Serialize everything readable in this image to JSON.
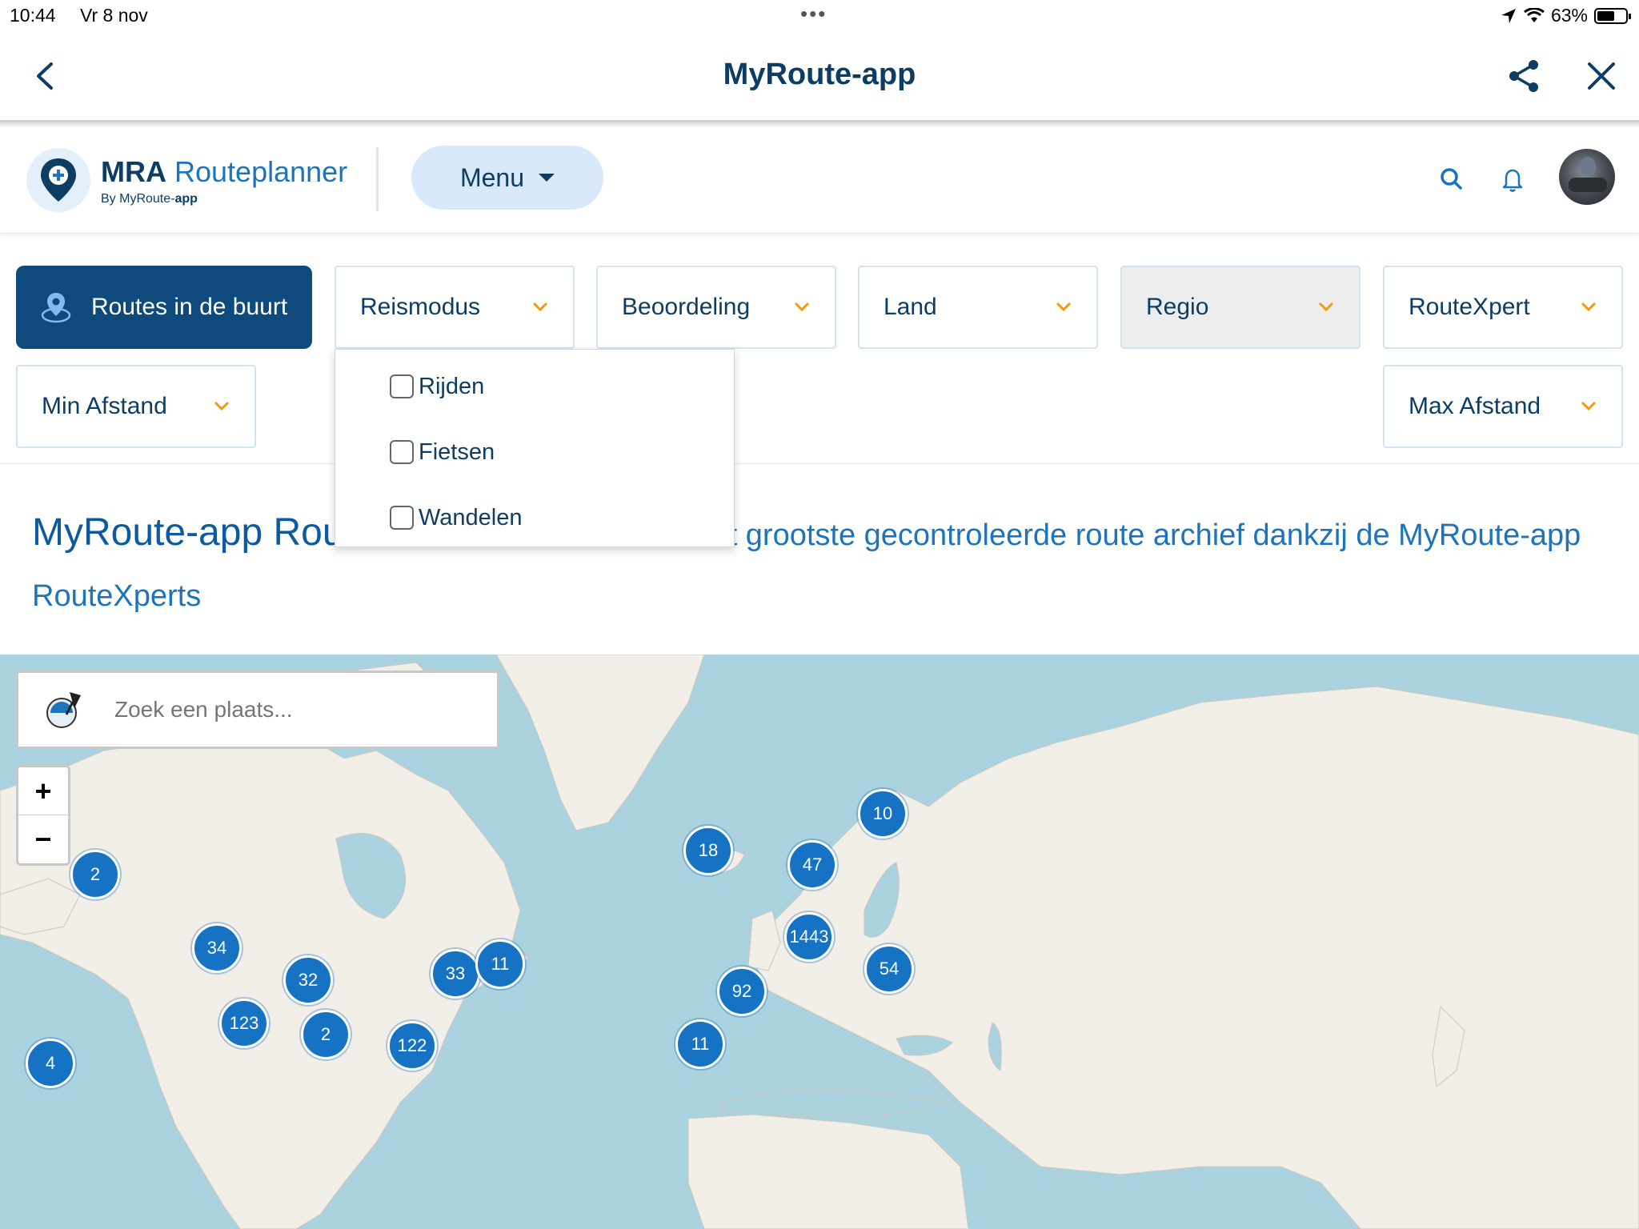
{
  "statusbar": {
    "time": "10:44",
    "date": "Vr 8 nov",
    "battery": "63%",
    "battery_level": 0.63
  },
  "navbar": {
    "title": "MyRoute-app"
  },
  "header": {
    "logo_brand_bold": "MRA",
    "logo_brand": "Routeplanner",
    "logo_sub_prefix": "By MyRoute-",
    "logo_sub_bold": "app",
    "menu_label": "Menu"
  },
  "filters": {
    "near": "Routes in de buurt",
    "travel_mode": "Reismodus",
    "rating": "Beoordeling",
    "country": "Land",
    "region": "Regio",
    "routexpert": "RouteXpert",
    "min_distance": "Min Afstand",
    "max_distance": "Max Afstand"
  },
  "dropdown": {
    "options": [
      {
        "label": "Rijden",
        "checked": false
      },
      {
        "label": "Fietsen",
        "checked": false
      },
      {
        "label": "Wandelen",
        "checked": false
      }
    ]
  },
  "heading": {
    "big": "MyRoute-app Rou",
    "rest": "et grootste gecontroleerde route archief dankzij de MyRoute-app",
    "line2": "RouteXperts"
  },
  "map": {
    "search_placeholder": "Zoek een plaats...",
    "zoom_in": "+",
    "zoom_out": "−",
    "clusters": [
      {
        "label": "2"
      },
      {
        "label": "34"
      },
      {
        "label": "32"
      },
      {
        "label": "33"
      },
      {
        "label": "11"
      },
      {
        "label": "123"
      },
      {
        "label": "2"
      },
      {
        "label": "122"
      },
      {
        "label": "4"
      },
      {
        "label": "18"
      },
      {
        "label": "47"
      },
      {
        "label": "10"
      },
      {
        "label": "1443"
      },
      {
        "label": "54"
      },
      {
        "label": "92"
      },
      {
        "label": "11"
      }
    ]
  },
  "colors": {
    "primary": "#0f4a7c",
    "accent": "#f39c12",
    "link": "#1e74bb",
    "map_water": "#aad3df",
    "map_land": "#f2efe9",
    "cluster": "#1673c4"
  }
}
